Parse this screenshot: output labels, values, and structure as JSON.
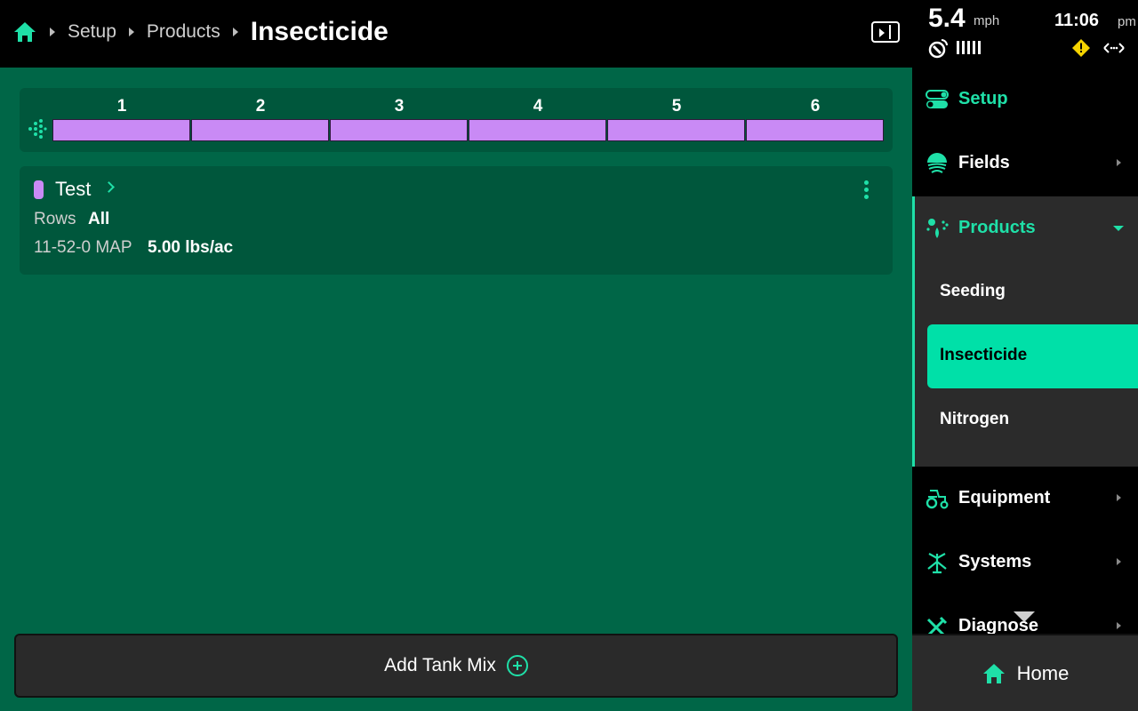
{
  "breadcrumb": {
    "items": [
      "Setup",
      "Products"
    ],
    "current": "Insecticide"
  },
  "status": {
    "speed": "5.4",
    "speed_unit": "mph",
    "time": "11:06",
    "ampm": "pm"
  },
  "rows": [
    "1",
    "2",
    "3",
    "4",
    "5",
    "6"
  ],
  "tank_card": {
    "title": "Test",
    "rows_label": "Rows",
    "rows_value": "All",
    "product_name": "11-52-0 MAP",
    "product_rate": "5.00 lbs/ac",
    "swatch_color": "#c98af5"
  },
  "add_tank_mix_label": "Add Tank Mix",
  "nav": {
    "setup": "Setup",
    "fields": "Fields",
    "products": "Products",
    "products_children": [
      "Seeding",
      "Insecticide",
      "Nitrogen"
    ],
    "equipment": "Equipment",
    "systems": "Systems",
    "diagnose": "Diagnose"
  },
  "home_label": "Home",
  "colors": {
    "accent": "#1fe0a8",
    "main_bg": "#006647",
    "panel_bg": "#00573c",
    "row_fill": "#c98af5",
    "warning": "#f5d300"
  }
}
